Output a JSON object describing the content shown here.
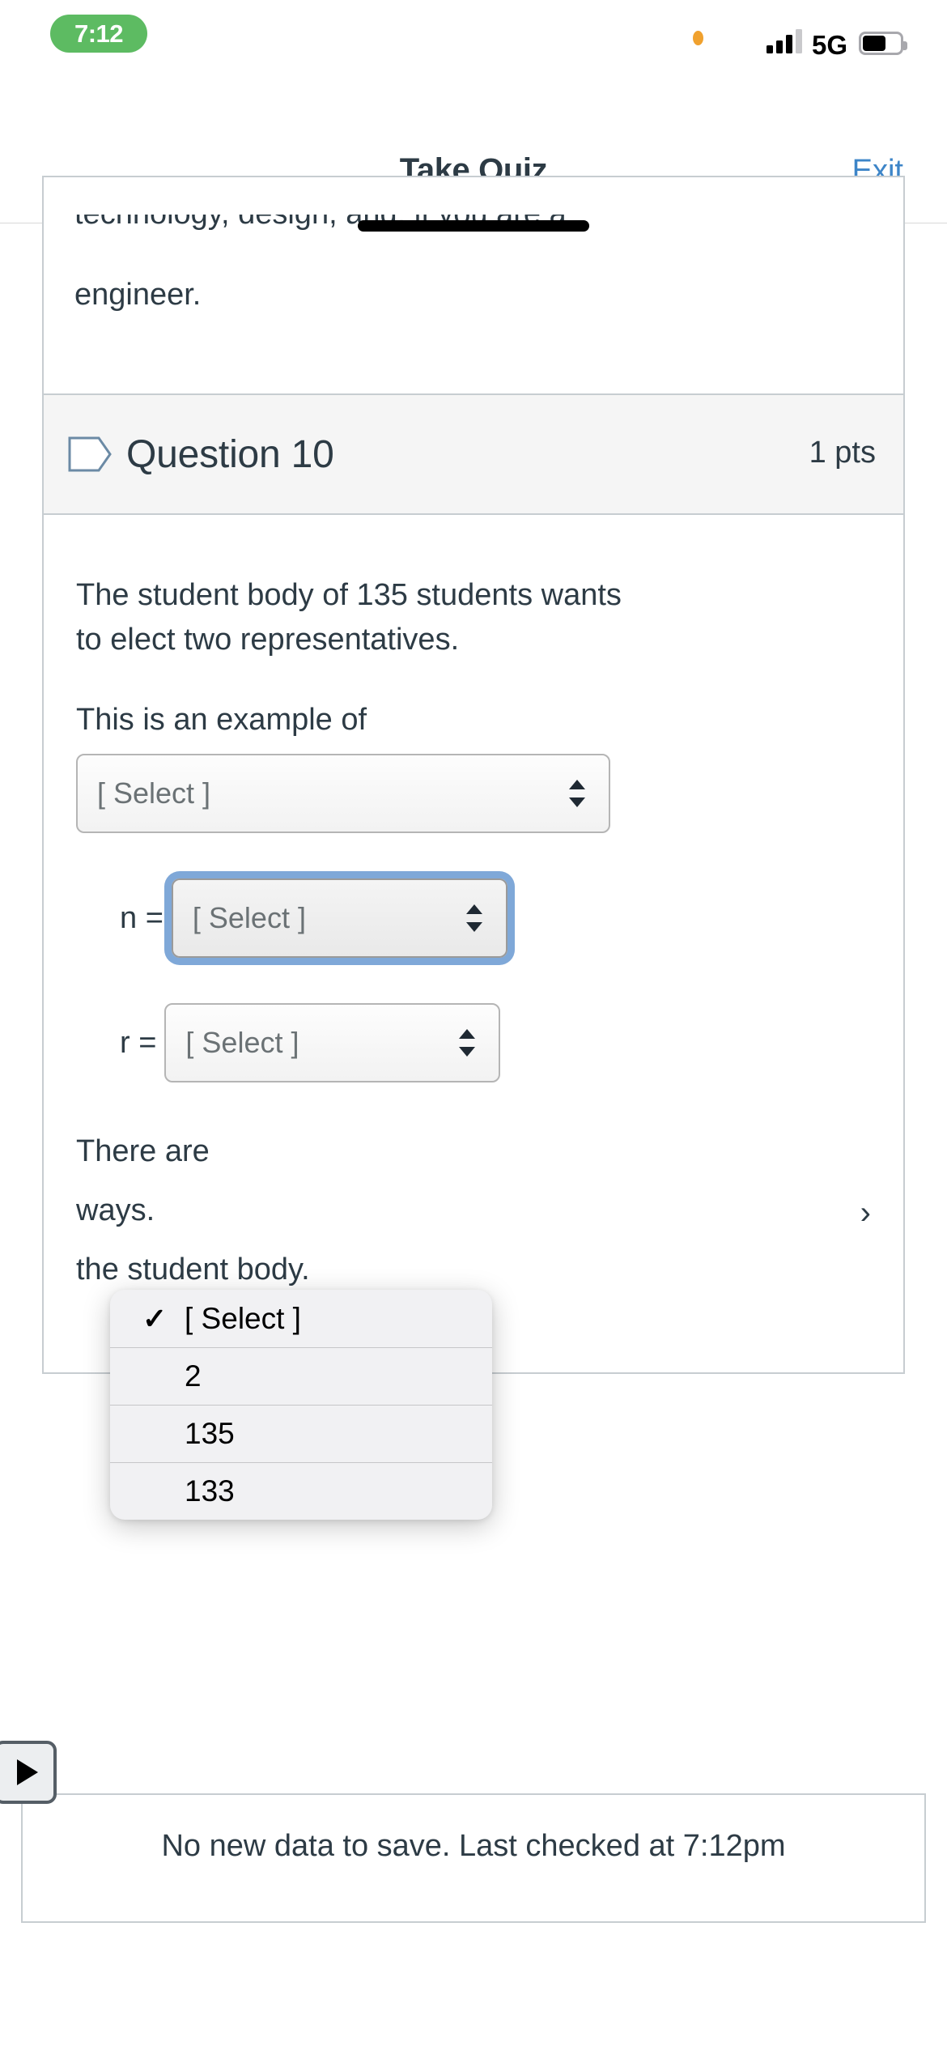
{
  "status_bar": {
    "time": "7:12",
    "recording_indicator": true,
    "network": "5G",
    "signal_bars_filled": 3,
    "signal_bars_total": 4,
    "battery_level_pct": 55,
    "privacy_dot_color": "#f0a12e",
    "recording_pill_color": "#5dbb62"
  },
  "nav_bar": {
    "title": "Take Quiz",
    "exit_label": "Exit",
    "exit_color": "#3d85c8"
  },
  "previous_question": {
    "cut_line": "technology, design, and, if you are a",
    "visible_line": "engineer."
  },
  "question": {
    "flag_icon": "flag-outline-icon",
    "title": "Question 10",
    "points": "1 pts",
    "prompt_line_1": "The student body of 135 students wants",
    "prompt_line_2": "to elect two representatives.",
    "intro_label": "This is an example of",
    "type_select_value": "[ Select ]",
    "n_label": "n =",
    "n_select_value": "[ Select ]",
    "r_label": "r =",
    "r_select_value": "[ Select ]",
    "tail_line_1": "There are",
    "tail_line_2": "ways.",
    "tail_line_3": "the student body.",
    "tail_select_value": ""
  },
  "dropdown": {
    "open_for": "n-select",
    "options": [
      {
        "label": "[ Select ]",
        "checked": true
      },
      {
        "label": "2",
        "checked": false
      },
      {
        "label": "135",
        "checked": false
      },
      {
        "label": "133",
        "checked": false
      }
    ],
    "check_glyph": "✓"
  },
  "floating_control": {
    "icon": "play-icon"
  },
  "save_bar": {
    "text": "No new data to save. Last checked at 7:12pm"
  }
}
